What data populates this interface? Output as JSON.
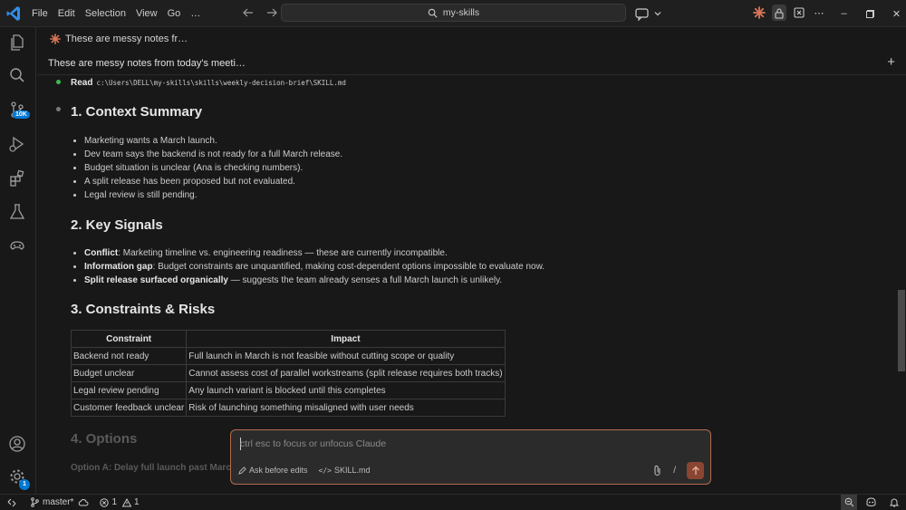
{
  "menu": [
    "File",
    "Edit",
    "Selection",
    "View",
    "Go",
    "…"
  ],
  "search": {
    "text": "my-skills"
  },
  "tab": {
    "title": "These are messy notes fr…"
  },
  "session": {
    "title": "These are messy notes from today's meeti…"
  },
  "activity": {
    "source_control_badge": "10K",
    "settings_badge": "1"
  },
  "read": {
    "label": "Read",
    "path": "c:\\Users\\DELL\\my-skills\\skills\\weekly-decision-brief\\SKILL.md"
  },
  "sections": {
    "context": {
      "heading": "1. Context Summary",
      "items": [
        "Marketing wants a March launch.",
        "Dev team says the backend is not ready for a full March release.",
        "Budget situation is unclear (Ana is checking numbers).",
        "A split release has been proposed but not evaluated.",
        "Legal review is still pending."
      ]
    },
    "signals": {
      "heading": "2. Key Signals",
      "items": [
        {
          "bold": "Conflict",
          "rest": ": Marketing timeline vs. engineering readiness — these are currently incompatible."
        },
        {
          "bold": "Information gap",
          "rest": ": Budget constraints are unquantified, making cost-dependent options impossible to evaluate now."
        },
        {
          "bold": "Split release surfaced organically",
          "rest": " — suggests the team already senses a full March launch is unlikely."
        }
      ]
    },
    "constraints": {
      "heading": "3. Constraints & Risks",
      "columns": [
        "Constraint",
        "Impact"
      ],
      "rows": [
        [
          "Backend not ready",
          "Full launch in March is not feasible without cutting scope or quality"
        ],
        [
          "Budget unclear",
          "Cannot assess cost of parallel workstreams (split release requires both tracks)"
        ],
        [
          "Legal review pending",
          "Any launch variant is blocked until this completes"
        ],
        [
          "Customer feedback unclear",
          "Risk of launching something misaligned with user needs"
        ]
      ]
    },
    "options": {
      "heading": "4. Options",
      "option_a": "Option A: Delay full launch past Marc"
    }
  },
  "chat": {
    "placeholder": "ctrl esc to focus or unfocus Claude",
    "mode_label": "Ask before edits",
    "file_label": "SKILL.md",
    "slash": "/"
  },
  "statusbar": {
    "branch": "master*",
    "errors": "1",
    "warnings": "1"
  },
  "colors": {
    "accent": "#d97757",
    "badge": "#0078d4",
    "dot_green": "#3fb950"
  }
}
